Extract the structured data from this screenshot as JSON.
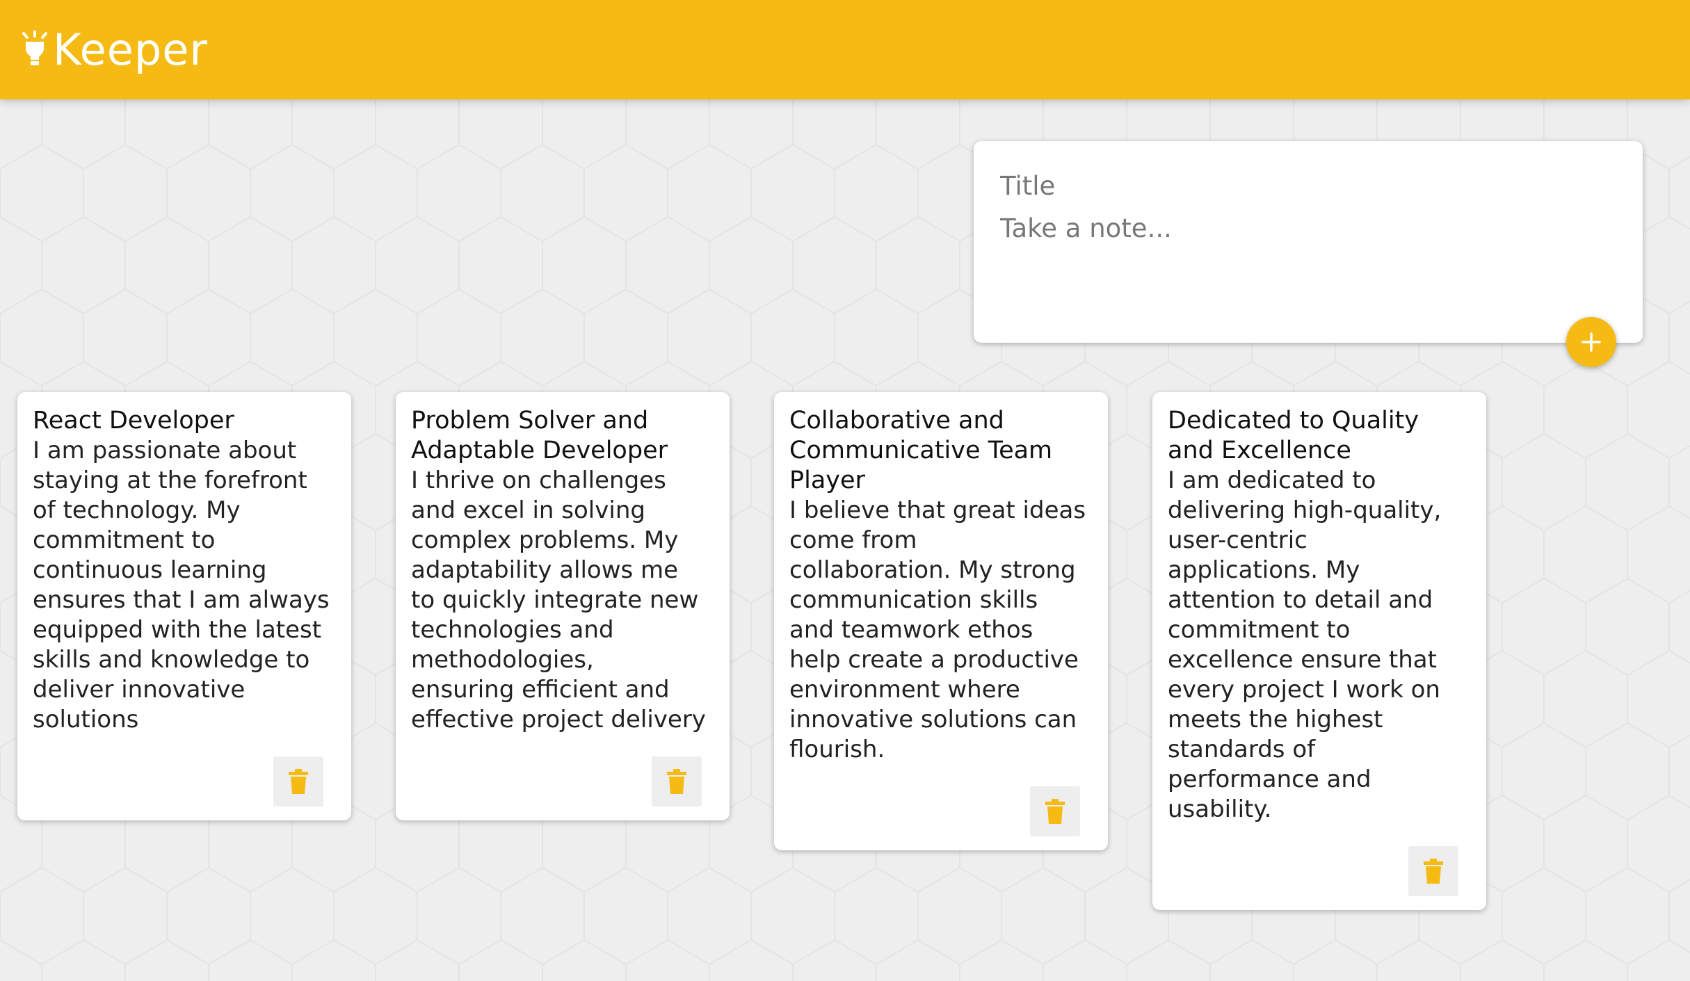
{
  "app": {
    "title": "Keeper",
    "accent_color": "#f5ba13",
    "logo_icon": "lightbulb-icon"
  },
  "composer": {
    "title_placeholder": "Title",
    "content_placeholder": "Take a note...",
    "add_icon": "plus-icon"
  },
  "notes": [
    {
      "title": "React Developer",
      "content": "I am passionate about\nstaying at the forefront\nof technology. My\ncommitment to\ncontinuous learning\nensures that I am always\nequipped with the latest\nskills and knowledge to\ndeliver innovative\nsolutions"
    },
    {
      "title": "Problem Solver and\nAdaptable Developer",
      "content": "I thrive on challenges\nand excel in solving\ncomplex problems. My\nadaptability allows me\nto quickly integrate new\ntechnologies and\nmethodologies,\nensuring efficient and\neffective project delivery"
    },
    {
      "title": "Collaborative and\nCommunicative Team\nPlayer",
      "content": "I believe that great ideas\ncome from\ncollaboration. My strong\ncommunication skills\nand teamwork ethos\nhelp create a productive\nenvironment where\ninnovative solutions can\nflourish."
    },
    {
      "title": "Dedicated to Quality\nand Excellence",
      "content": "I am dedicated to\ndelivering high-quality,\nuser-centric\napplications. My\nattention to detail and\ncommitment to\nexcellence ensure that\nevery project I work on\nmeets the highest\nstandards of\nperformance and\nusability."
    }
  ],
  "delete_icon": "trash-icon"
}
